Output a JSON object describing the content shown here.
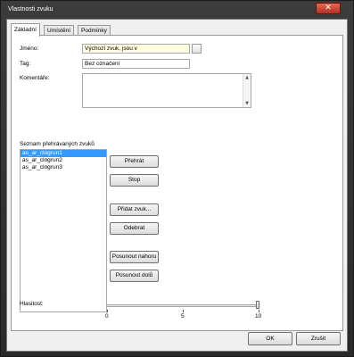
{
  "window": {
    "title": "Vlastnosti zvuku",
    "close_glyph": "✕"
  },
  "tabs": [
    {
      "label": "Základní",
      "active": true
    },
    {
      "label": "Umístění",
      "active": false
    },
    {
      "label": "Podmínky",
      "active": false
    }
  ],
  "form": {
    "name_label": "Jméno:",
    "name_value": "Výchozí zvuk, jsou v",
    "tag_label": "Tag:",
    "tag_value": "Bez označení",
    "comments_label": "Komentáře:",
    "comments_value": ""
  },
  "soundlist": {
    "label": "Seznam přehrávaných zvuků",
    "items": [
      {
        "label": "as_ar_clogrun1",
        "selected": true
      },
      {
        "label": "as_ar_clogrun2",
        "selected": false
      },
      {
        "label": "as_ar_clogrun3",
        "selected": false
      }
    ]
  },
  "buttons": {
    "play": "Přehrát",
    "stop": "Stop",
    "add_sound": "Přidat zvuk...",
    "remove": "Odebrat",
    "move_up": "Posunout nahoru",
    "move_down": "Posunout dolů"
  },
  "volume": {
    "label": "Hlasitost:",
    "min": 0,
    "mid": 5,
    "max": 10,
    "min_label": "0",
    "mid_label": "5",
    "max_label": "10",
    "value": 10
  },
  "dialog": {
    "ok": "OK",
    "cancel": "Zrušit"
  }
}
